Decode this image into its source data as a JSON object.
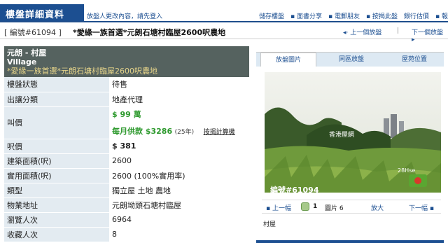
{
  "header": {
    "brand": "樓盤詳細資料",
    "login_hint": "放盤人更改內容，請先登入",
    "links": [
      "儲存樓盤",
      "▪ 面書分享",
      "▪ 電郵朋友",
      "▪ 按揭此盤",
      "銀行估價",
      "▪ 報告"
    ]
  },
  "listing": {
    "ref": "[ 編號#61094 ]",
    "title": "*愛緣一族首選*元朗石塘村臨屋2600呎農地",
    "prev": "◂· 上一個放盤",
    "separator": "|",
    "next": "下一個放盤 ▸"
  },
  "summary": {
    "district": "元朗 - 村屋",
    "type_en": "Village",
    "subtitle": "*愛緣一族首選*元朗石塘村臨屋2600呎農地"
  },
  "details": {
    "status_k": "樓盤狀態",
    "status_v": "待售",
    "source_k": "出讓分類",
    "source_v": "地產代理",
    "price_k": "叫價",
    "price_v": "$ 99 萬",
    "mortgage_v": "每月供款 $3286",
    "mortgage_term": "(25年)",
    "calc_link": "按揭計算機",
    "psf_k": "呎價",
    "psf_v": "$ 381",
    "gross_k": "建築面積(呎)",
    "gross_v": "2600",
    "net_k": "實用面積(呎)",
    "net_v": "2600 (100%實用率)",
    "kind_k": "類型",
    "kind_v": "獨立屋 土地 農地",
    "addr_k": "物業地址",
    "addr_v": "元朗坳頭石塘村臨屋",
    "views_k": "瀏覽人次",
    "views_v": "6964",
    "fav_k": "收藏人次",
    "fav_v": "8"
  },
  "gallery": {
    "tabs": [
      "放盤圖片",
      "同區放盤",
      "屋苑位置"
    ],
    "photo_tag": "編號#61094",
    "photo_label": "香港屋網",
    "photo_logo": "28Hse",
    "prev": "▪ 上一幅",
    "count": "1",
    "img_label": "圖片 6",
    "zoom": "放大",
    "next": "下一幅 ▪",
    "caption": "村屋"
  },
  "colors": {
    "brand_blue": "#1c4f91",
    "accent_green": "#2f9a2f",
    "header_bg": "#55625f"
  }
}
